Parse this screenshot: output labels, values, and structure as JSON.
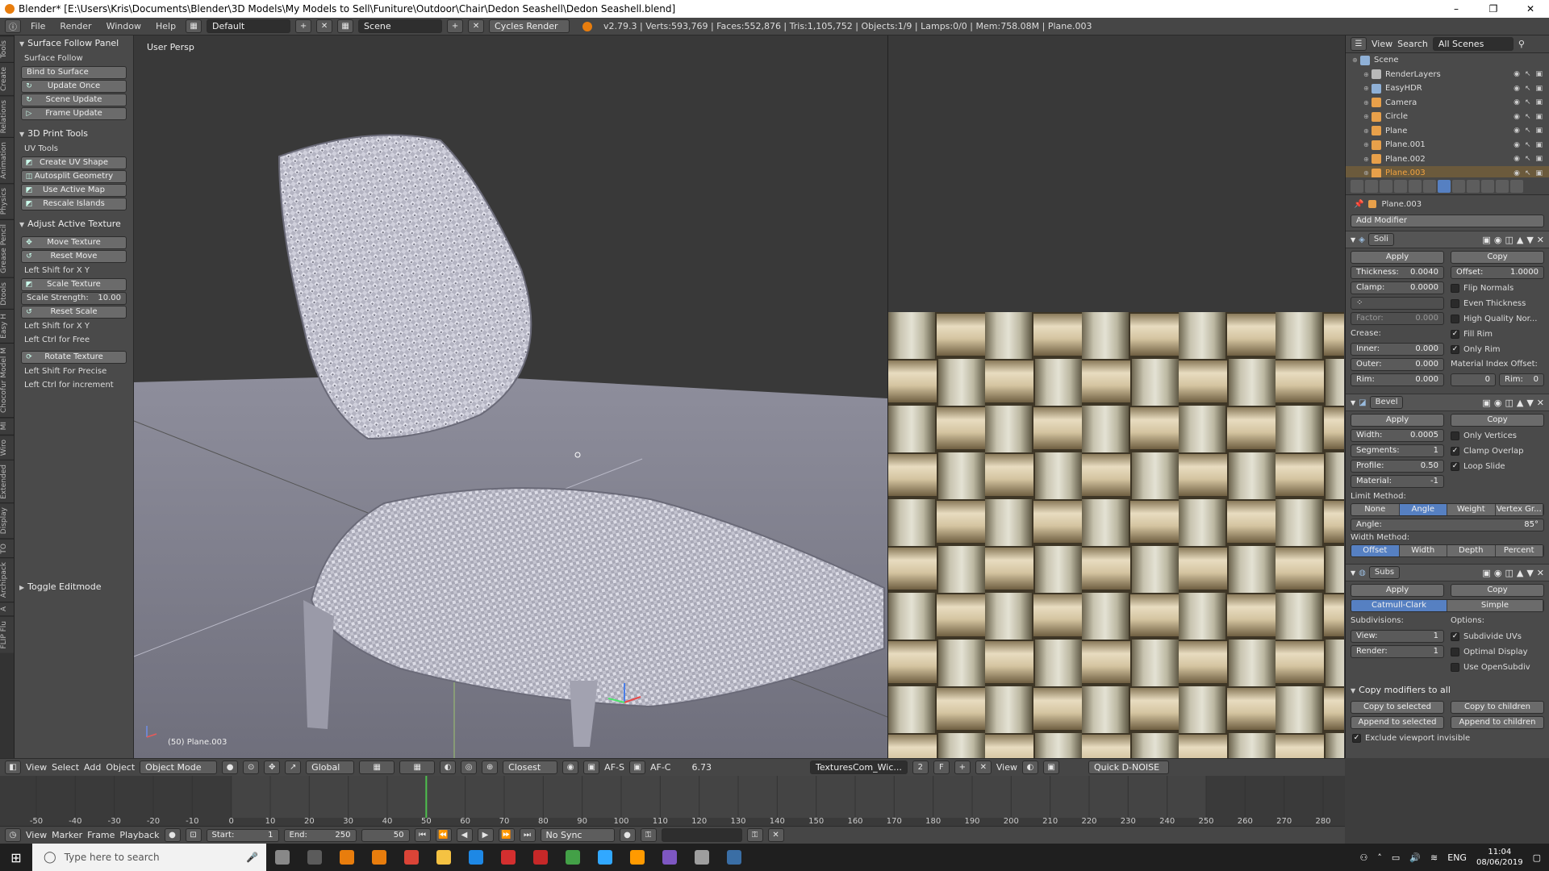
{
  "window": {
    "title": "Blender* [E:\\Users\\Kris\\Documents\\Blender\\3D Models\\My Models to Sell\\Funiture\\Outdoor\\Chair\\Dedon Seashell\\Dedon Seashell.blend]",
    "controls": [
      "–",
      "❐",
      "✕"
    ]
  },
  "menubar": {
    "items": [
      "File",
      "Render",
      "Window",
      "Help"
    ],
    "layout": "Default",
    "scene": "Scene",
    "engine": "Cycles Render",
    "stats": "v2.79.3 | Verts:593,769 | Faces:552,876 | Tris:1,105,752 | Objects:1/9 | Lamps:0/0 | Mem:758.08M | Plane.003"
  },
  "vtabs": [
    "Tools",
    "Create",
    "Relations",
    "Animation",
    "Physics",
    "Grease Pencil",
    "Dtools",
    "Easy H",
    "Chocofur Model M",
    "MI",
    "Wiro",
    "Extended",
    "Display",
    "TO",
    "Archipack",
    "A",
    "FLIP Flu"
  ],
  "toolshelf": {
    "surface_follow": {
      "title": "Surface Follow Panel",
      "label": "Surface Follow",
      "bind": "Bind to Surface",
      "update_once": "Update Once",
      "scene_update": "Scene Update",
      "frame_update": "Frame Update"
    },
    "print_tools": {
      "title": "3D Print Tools",
      "label": "UV Tools",
      "create_uv": "Create UV Shape",
      "autosplit": "Autosplit Geometry",
      "active_map": "Use Active Map",
      "rescale": "Rescale Islands"
    },
    "adjust": {
      "title": "Adjust Active Texture",
      "move": "Move Texture",
      "reset_move": "Reset Move",
      "hint1": "Left Shift for X Y",
      "scale": "Scale Texture",
      "strength_label": "Scale Strength:",
      "strength_value": "10.00",
      "reset_scale": "Reset Scale",
      "hint2": "Left Shift for X Y",
      "hint3": "Left Ctrl for Free",
      "rotate": "Rotate Texture",
      "hint4": "Left Shift For Precise",
      "hint5": "Left Ctrl for increment"
    },
    "toggle": "Toggle Editmode"
  },
  "viewport": {
    "label": "User Persp",
    "object": "(50) Plane.003"
  },
  "outliner": {
    "view": "View",
    "search": "Search",
    "filter": "All Scenes",
    "items": [
      {
        "name": "Scene",
        "color": "#8fb0d6",
        "selected": false,
        "depth": 0
      },
      {
        "name": "RenderLayers",
        "color": "#b9b9b9",
        "selected": false,
        "depth": 1
      },
      {
        "name": "EasyHDR",
        "color": "#8fb0d6",
        "selected": false,
        "depth": 1
      },
      {
        "name": "Camera",
        "color": "#e8a04a",
        "selected": false,
        "depth": 1
      },
      {
        "name": "Circle",
        "color": "#e8a04a",
        "selected": false,
        "depth": 1
      },
      {
        "name": "Plane",
        "color": "#e8a04a",
        "selected": false,
        "depth": 1
      },
      {
        "name": "Plane.001",
        "color": "#e8a04a",
        "selected": false,
        "depth": 1
      },
      {
        "name": "Plane.002",
        "color": "#e8a04a",
        "selected": false,
        "depth": 1
      },
      {
        "name": "Plane.003",
        "color": "#e8a04a",
        "selected": true,
        "depth": 1
      }
    ]
  },
  "properties": {
    "context": "Plane.003",
    "add_modifier": "Add Modifier",
    "apply": "Apply",
    "copy": "Copy",
    "solidify": {
      "name": "Soli",
      "thickness_label": "Thickness:",
      "thickness": "0.0040",
      "offset_label": "Offset:",
      "offset": "1.0000",
      "clamp_label": "Clamp:",
      "clamp": "0.0000",
      "flip": "Flip Normals",
      "even": "Even Thickness",
      "hq": "High Quality Nor...",
      "factor_label": "Factor:",
      "factor": "0.000",
      "fill_rim": "Fill Rim",
      "only_rim": "Only Rim",
      "crease": "Crease:",
      "inner_label": "Inner:",
      "inner": "0.000",
      "outer_label": "Outer:",
      "outer": "0.000",
      "rim_label": "Rim:",
      "rim": "0.000",
      "mat_offset": "Material Index Offset:",
      "mat_val": "0",
      "rim2_label": "Rim:",
      "rim2": "0"
    },
    "bevel": {
      "name": "Bevel",
      "width_label": "Width:",
      "width": "0.0005",
      "segments_label": "Segments:",
      "segments": "1",
      "profile_label": "Profile:",
      "profile": "0.50",
      "material_label": "Material:",
      "material": "-1",
      "only_vertices": "Only Vertices",
      "clamp_overlap": "Clamp Overlap",
      "loop_slide": "Loop Slide",
      "limit": "Limit Method:",
      "limit_opts": [
        "None",
        "Angle",
        "Weight",
        "Vertex Gr..."
      ],
      "angle_label": "Angle:",
      "angle": "85°",
      "width_method": "Width Method:",
      "width_opts": [
        "Offset",
        "Width",
        "Depth",
        "Percent"
      ]
    },
    "subsurf": {
      "name": "Subs",
      "types": [
        "Catmull-Clark",
        "Simple"
      ],
      "subdivisions": "Subdivisions:",
      "options": "Options:",
      "view_label": "View:",
      "view": "1",
      "render_label": "Render:",
      "render": "1",
      "subdiv_uvs": "Subdivide UVs",
      "optimal": "Optimal Display",
      "opensubdiv": "Use OpenSubdiv"
    },
    "copy_all": "Copy modifiers to all",
    "copy_sel": "Copy to selected",
    "copy_children": "Copy to children",
    "append_sel": "Append to selected",
    "append_children": "Append to children",
    "exclude": "Exclude viewport invisible"
  },
  "vp_header": {
    "view": "View",
    "select": "Select",
    "add": "Add",
    "object": "Object",
    "mode": "Object Mode",
    "orientation": "Global",
    "snap": "Closest",
    "af_s": "AF-S",
    "af_c": "AF-C",
    "fstop": "6.73",
    "image": "TexturesCom_Wic...",
    "users": "2",
    "f": "F",
    "img_view": "View",
    "denoise": "Quick D-NOISE"
  },
  "timeline": {
    "ticks": [
      "-50",
      "-40",
      "-30",
      "-20",
      "-10",
      "0",
      "10",
      "20",
      "30",
      "40",
      "50",
      "60",
      "70",
      "80",
      "90",
      "100",
      "110",
      "120",
      "130",
      "140",
      "150",
      "160",
      "170",
      "180",
      "190",
      "200",
      "210",
      "220",
      "230",
      "240",
      "250",
      "260",
      "270",
      "280"
    ],
    "current": 50,
    "start": 0,
    "end": 250,
    "view": "View",
    "marker": "Marker",
    "frame": "Frame",
    "playback": "Playback",
    "start_label": "Start:",
    "start_val": "1",
    "end_label": "End:",
    "end_val": "250",
    "cur_val": "50",
    "sync": "No Sync"
  },
  "taskbar": {
    "search": "Type here to search",
    "lang": "ENG",
    "time": "11:04",
    "date": "08/06/2019",
    "apps": [
      {
        "name": "task-view",
        "color": "#888"
      },
      {
        "name": "calculator",
        "color": "#5b5b5b"
      },
      {
        "name": "blender",
        "color": "#e87d0d"
      },
      {
        "name": "blender-2",
        "color": "#e87d0d"
      },
      {
        "name": "chrome",
        "color": "#db4437"
      },
      {
        "name": "explorer",
        "color": "#f5c242"
      },
      {
        "name": "app-blue",
        "color": "#1e88e5"
      },
      {
        "name": "app-red",
        "color": "#d32f2f"
      },
      {
        "name": "app-red-2",
        "color": "#c62828"
      },
      {
        "name": "play",
        "color": "#43a047"
      },
      {
        "name": "photoshop",
        "color": "#31a8ff"
      },
      {
        "name": "illustrator",
        "color": "#ff9a00"
      },
      {
        "name": "app-multi",
        "color": "#7e57c2"
      },
      {
        "name": "app-gray",
        "color": "#9e9e9e"
      },
      {
        "name": "photos",
        "color": "#3a6ea5"
      }
    ]
  }
}
